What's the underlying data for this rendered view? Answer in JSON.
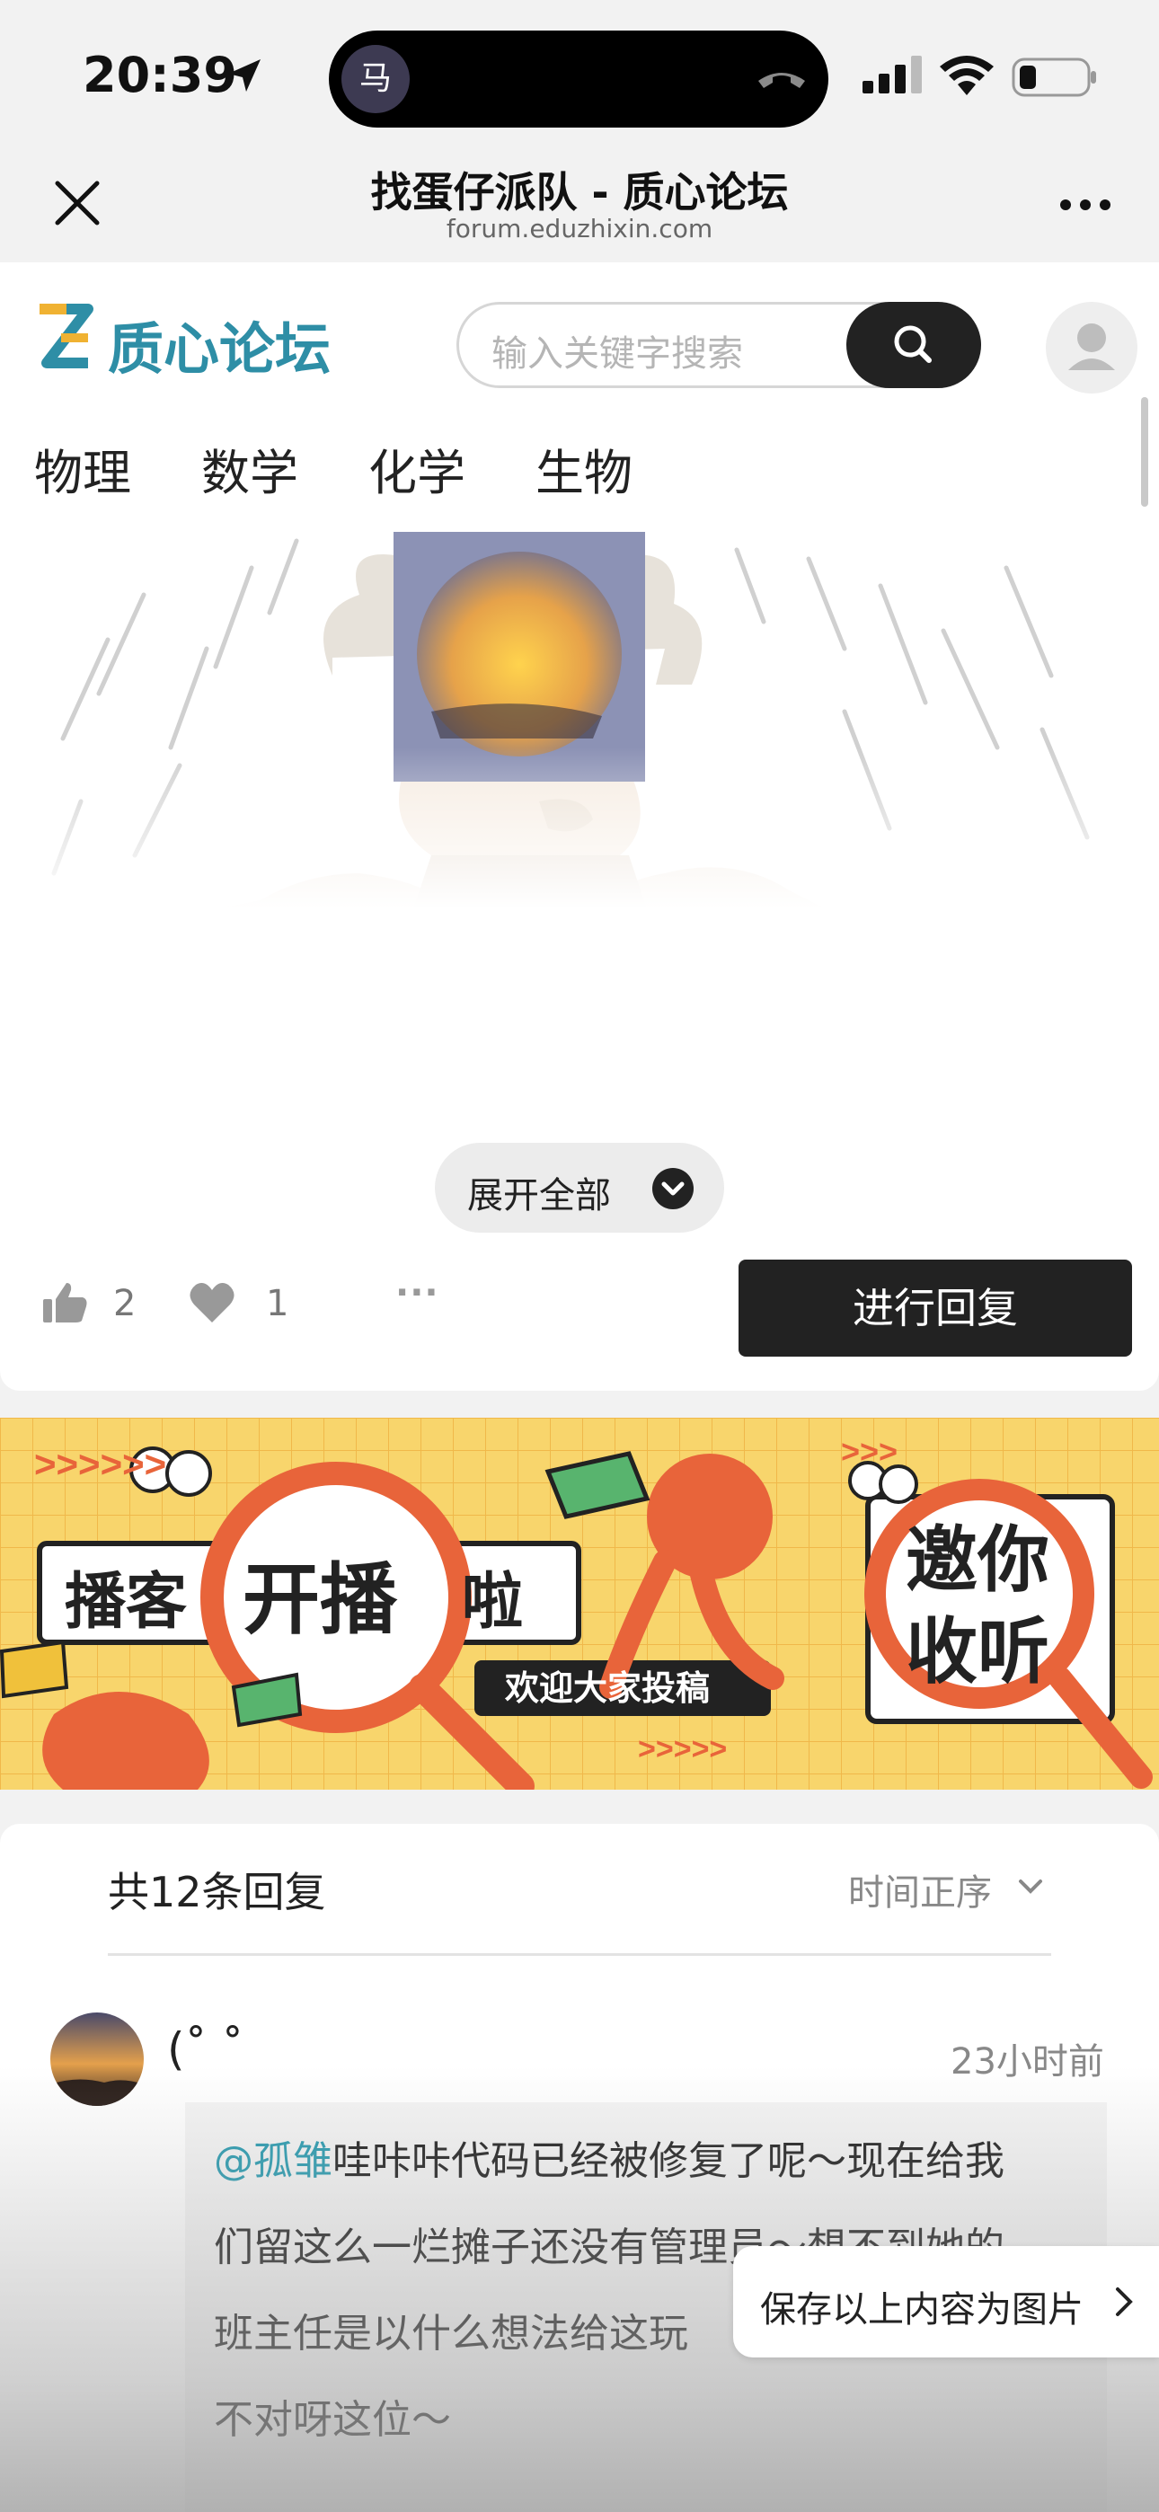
{
  "status_bar": {
    "time": "20:39",
    "island_contact_initial": "马",
    "icons": [
      "location-arrow-icon",
      "end-call-icon",
      "signal-icon",
      "wifi-icon",
      "battery-icon"
    ]
  },
  "nav": {
    "title": "找蛋仔派队 - 质心论坛",
    "url": "forum.eduzhixin.com",
    "close_icon": "close-icon",
    "more_label": "..."
  },
  "site": {
    "logo_text": "质心论坛",
    "search_placeholder": "输入关键字搜索",
    "brand_color": "#2e8ea6"
  },
  "tabs": [
    "物理",
    "数学",
    "化学",
    "生物"
  ],
  "post": {
    "expand_label": "展开全部",
    "likes": "2",
    "favorites": "1",
    "more_label": "···",
    "reply_button": "进行回复"
  },
  "banner": {
    "text_left_1": "播客",
    "text_left_2": "开播",
    "text_left_3": "啦",
    "subtitle": "欢迎大家投稿",
    "text_right_1": "邀你",
    "text_right_2": "收听",
    "arrows_left": ">>>>>>",
    "arrows_mid": ">>>>>",
    "arrows_right": ">>>"
  },
  "replies": {
    "count_label": "共12条回复",
    "sort_label": "时间正序",
    "comments": [
      {
        "name": "(˚ ˚",
        "time": "23小时前",
        "mention": "@孤雏",
        "text_line1": "哇咔咔代码已经被修复了呢～现在给我",
        "text_line2": "们留这么一烂摊子还没有管理员～想不到她的",
        "text_line3": "班主任是以什么想法给这玩",
        "text_line4": "不对呀这位～"
      }
    ]
  },
  "save_prompt": "保存以上内容为图片"
}
